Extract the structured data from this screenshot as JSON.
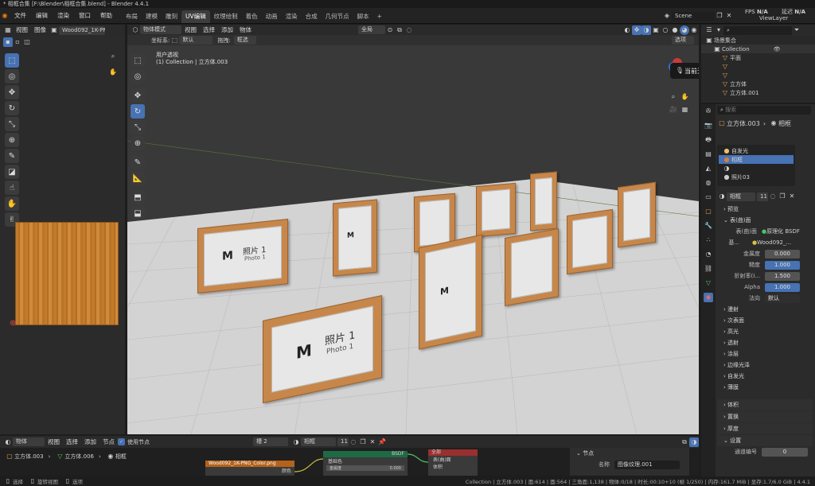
{
  "window": {
    "title": "* 相框合集 [F:\\Blender\\相框合集.blend] - Blender 4.4.1"
  },
  "menu": {
    "items": [
      "文件",
      "编辑",
      "渲染",
      "窗口",
      "帮助"
    ]
  },
  "workspaces": {
    "tabs": [
      "布局",
      "建模",
      "雕刻",
      "UV编辑",
      "纹理绘制",
      "着色",
      "动画",
      "渲染",
      "合成",
      "几何节点",
      "脚本",
      "+"
    ],
    "active": "UV编辑"
  },
  "topright": {
    "scene": "Scene",
    "fps_label": "FPS",
    "fps_value": "N/A",
    "delay_label": "延迟",
    "delay_value": "N/A",
    "view_layer": "ViewLayer"
  },
  "uv_editor": {
    "view": "视图",
    "image": "图像",
    "image_name": "Wood092_1K-PNG_"
  },
  "viewport": {
    "mode": "物体模式",
    "view": "视图",
    "select": "选择",
    "add": "添加",
    "object": "物体",
    "global": "全局",
    "options": "选项",
    "coord_label": "坐标系:",
    "coord_value": "默认",
    "drag_label": "拖拽:",
    "drag_value": "框选",
    "overlay_line1": "用户透视",
    "overlay_line2": "(1) Collection | 立方体.003",
    "tooltip": "当前无成员发言",
    "photo_label": "照片 1",
    "photo_sub": "Photo 1"
  },
  "outliner": {
    "root": "场景集合",
    "items": [
      "Collection",
      "平面",
      "立方体",
      "立方体.001"
    ]
  },
  "properties": {
    "search_placeholder": "搜索",
    "breadcrumb_obj": "立方体.003",
    "breadcrumb_mat": "相框",
    "slots": [
      "自发光",
      "相框",
      "",
      "照片03"
    ],
    "material_name": "相框",
    "users": "11",
    "sec_preview": "预览",
    "sec_surface": "表(曲)面",
    "surface_label": "表(曲)面",
    "surface_value": "原理化 BSDF",
    "base_label": "基...",
    "base_value": "Wood092_...",
    "metal_label": "金属度",
    "metal_value": "0.000",
    "rough_label": "糙度",
    "rough_value": "1.000",
    "ior_label": "折射率(I...",
    "ior_value": "1.500",
    "alpha_label": "Alpha",
    "alpha_value": "1.000",
    "normal_label": "法向",
    "normal_value": "默认",
    "subsections": [
      "漫射",
      "次表面",
      "高光",
      "透射",
      "涂层",
      "边缘光泽",
      "自发光",
      "薄膜"
    ],
    "sec_volume": "体积",
    "sec_displace": "置换",
    "sec_thickness": "厚度",
    "sec_settings": "设置",
    "pass_label": "通道编号",
    "pass_value": "0"
  },
  "node_editor": {
    "type": "物体",
    "view": "视图",
    "select": "选择",
    "add": "添加",
    "node": "节点",
    "use_nodes": "使用节点",
    "slot": "槽 2",
    "material": "相框",
    "users": "11",
    "bc_obj": "立方体.003",
    "bc_obj2": "立方体.006",
    "bc_mat": "相框",
    "img_node": "Wood092_1K-PNG_Color.png",
    "bsdf": "BSDF",
    "bsdf_label": "全部",
    "base_color": "基础色",
    "metal": "金属度",
    "metal_val": "0.000",
    "surf_out": "表(曲)面",
    "vol_out": "体积",
    "side_node": "节点",
    "name_label": "名称",
    "name_value": "图像纹理.001",
    "color_out": "颜色"
  },
  "status": {
    "select": "选择",
    "rotate": "旋转视图",
    "options": "选项",
    "info": "Collection | 立方体.003 | 面:614 | 面:564 | 三角面:1,138 | 物体:0/18 | 时长:00:10+10 (帧 1/250) | 内存:161.7 MiB | 显存:1.7/6.0 GiB | 4.4.1"
  },
  "colors": {
    "accent": "#4772b3",
    "wood": "#c7874a",
    "bg": "#1d1d1d"
  }
}
